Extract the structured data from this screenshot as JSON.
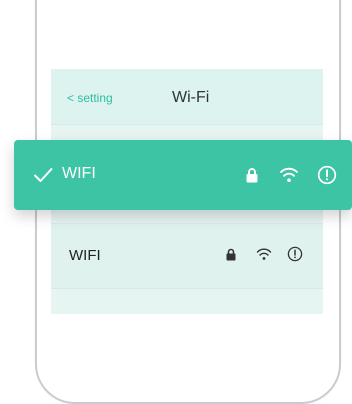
{
  "nav": {
    "back_label": "< setting",
    "title": "Wi-Fi"
  },
  "networks": [
    {
      "name": "WIFI",
      "selected": true,
      "locked": true,
      "icons": [
        "check-icon",
        "lock-icon",
        "wifi-icon",
        "info-icon"
      ]
    },
    {
      "name": "WIFI",
      "selected": false,
      "locked": true,
      "icons": [
        "lock-icon",
        "wifi-icon",
        "info-icon"
      ]
    }
  ],
  "colors": {
    "accent": "#3cc4a5",
    "screen_bg": "#e6f4f2",
    "nav_bg": "#dcf3ef",
    "back_link": "#2fbea2",
    "frame": "#c9cbcc"
  }
}
